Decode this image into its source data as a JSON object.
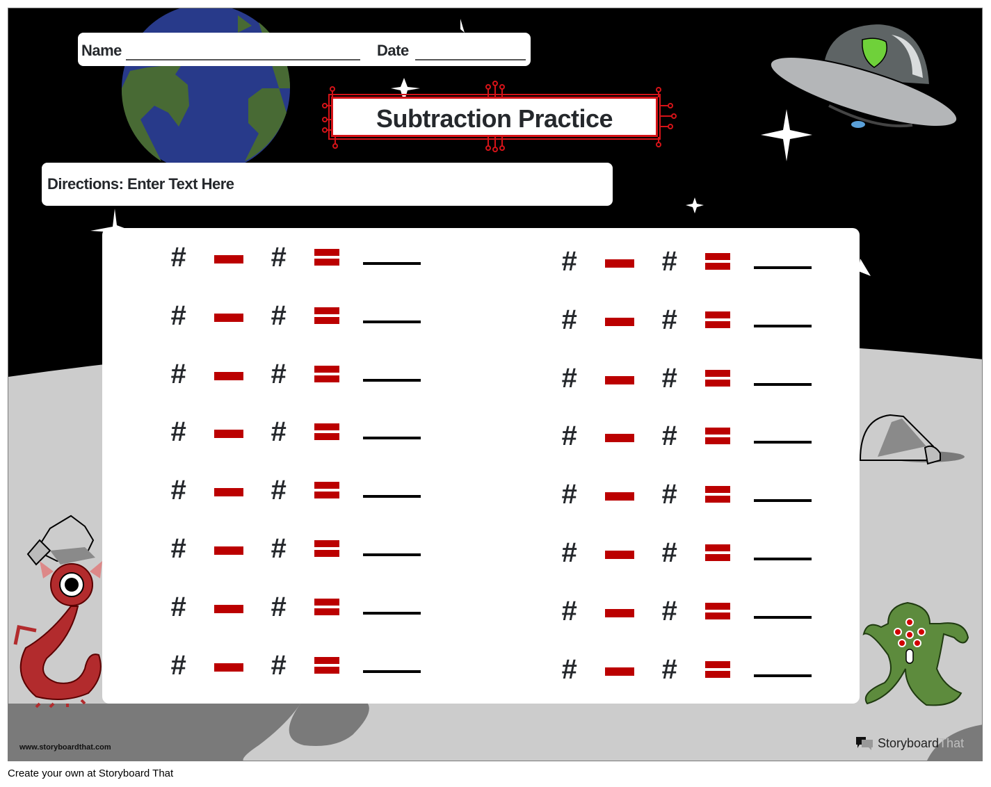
{
  "worksheet": {
    "name_label": "Name",
    "date_label": "Date",
    "title": "Subtraction Practice",
    "directions": "Directions: Enter Text Here",
    "problem_symbols": {
      "operand": "#",
      "operator": "minus",
      "equals": "equals",
      "answer": "blank line"
    },
    "left_column_count": 8,
    "right_column_count": 8
  },
  "branding": {
    "url": "www.storyboardthat.com",
    "logo_word1": "Storyboard",
    "logo_word2": "That",
    "footer": "Create your own at Storyboard That"
  },
  "colors": {
    "accent_red": "#bb0000",
    "title_border": "#d51318",
    "space": "#000000",
    "moon_light": "#cccccc",
    "moon_dark": "#7a7a7a",
    "earth_ocean": "#283a8a",
    "earth_land": "#486a34"
  }
}
